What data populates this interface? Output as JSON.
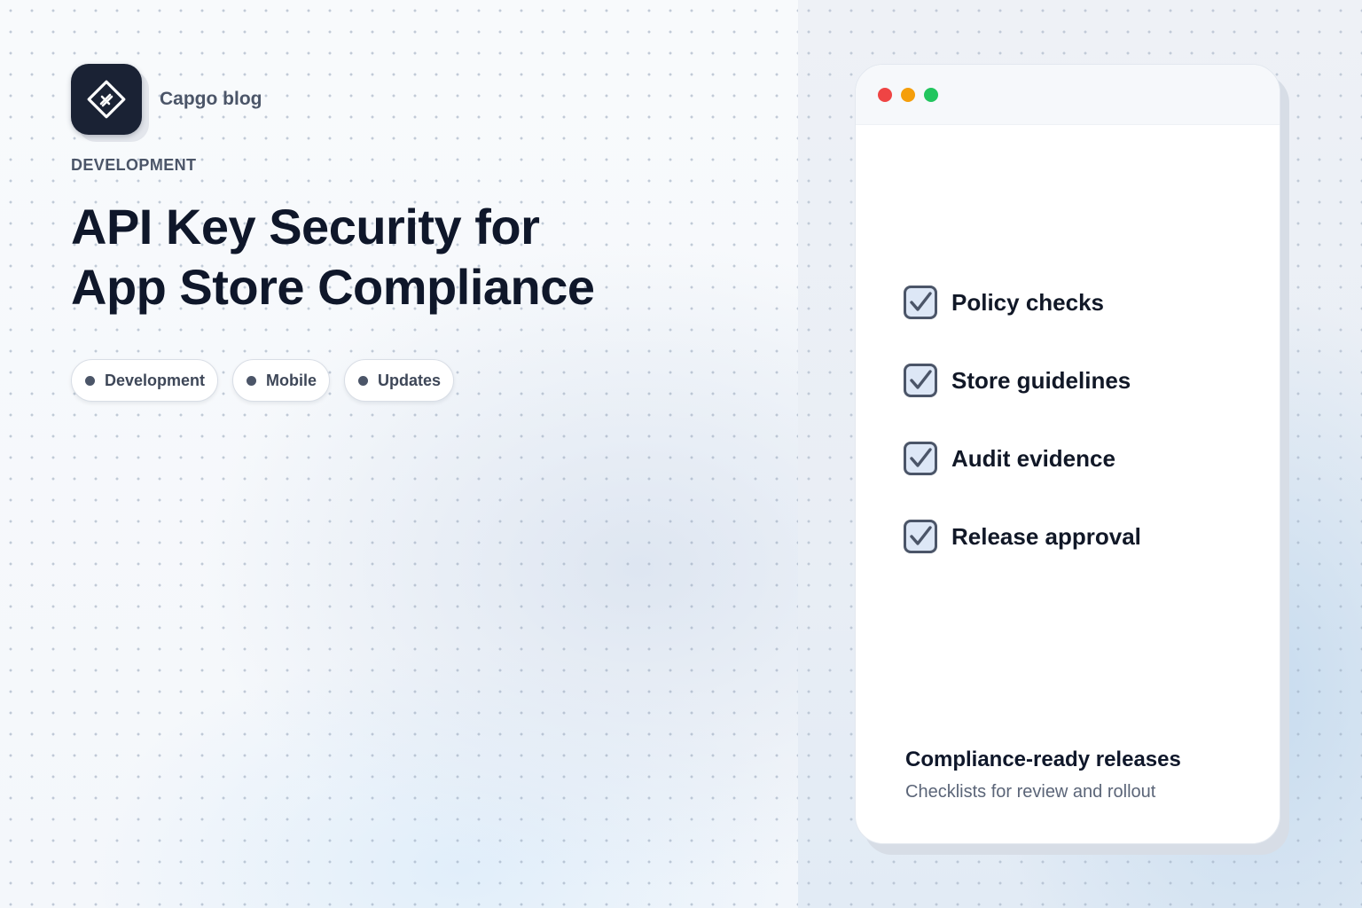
{
  "brand": {
    "name": "Capgo blog",
    "logo_icon": "capgo-diamond-icon"
  },
  "article": {
    "category": "DEVELOPMENT",
    "title_line1": "API Key Security for",
    "title_line2": "App Store Compliance"
  },
  "tags": [
    {
      "label": "Development"
    },
    {
      "label": "Mobile"
    },
    {
      "label": "Updates"
    }
  ],
  "card": {
    "window_controls": {
      "close_color": "#ef4444",
      "minimize_color": "#f59e0b",
      "maximize_color": "#22c55e"
    },
    "checklist": [
      {
        "label": "Policy checks",
        "checked": true
      },
      {
        "label": "Store guidelines",
        "checked": true
      },
      {
        "label": "Audit evidence",
        "checked": true
      },
      {
        "label": "Release approval",
        "checked": true
      }
    ],
    "footer_title": "Compliance-ready releases",
    "footer_subtitle": "Checklists for review and rollout"
  },
  "colors": {
    "logo_bg": "#1a2234",
    "heading": "#0f172a",
    "muted": "#4b5568",
    "check_fill": "#dde7f6"
  }
}
